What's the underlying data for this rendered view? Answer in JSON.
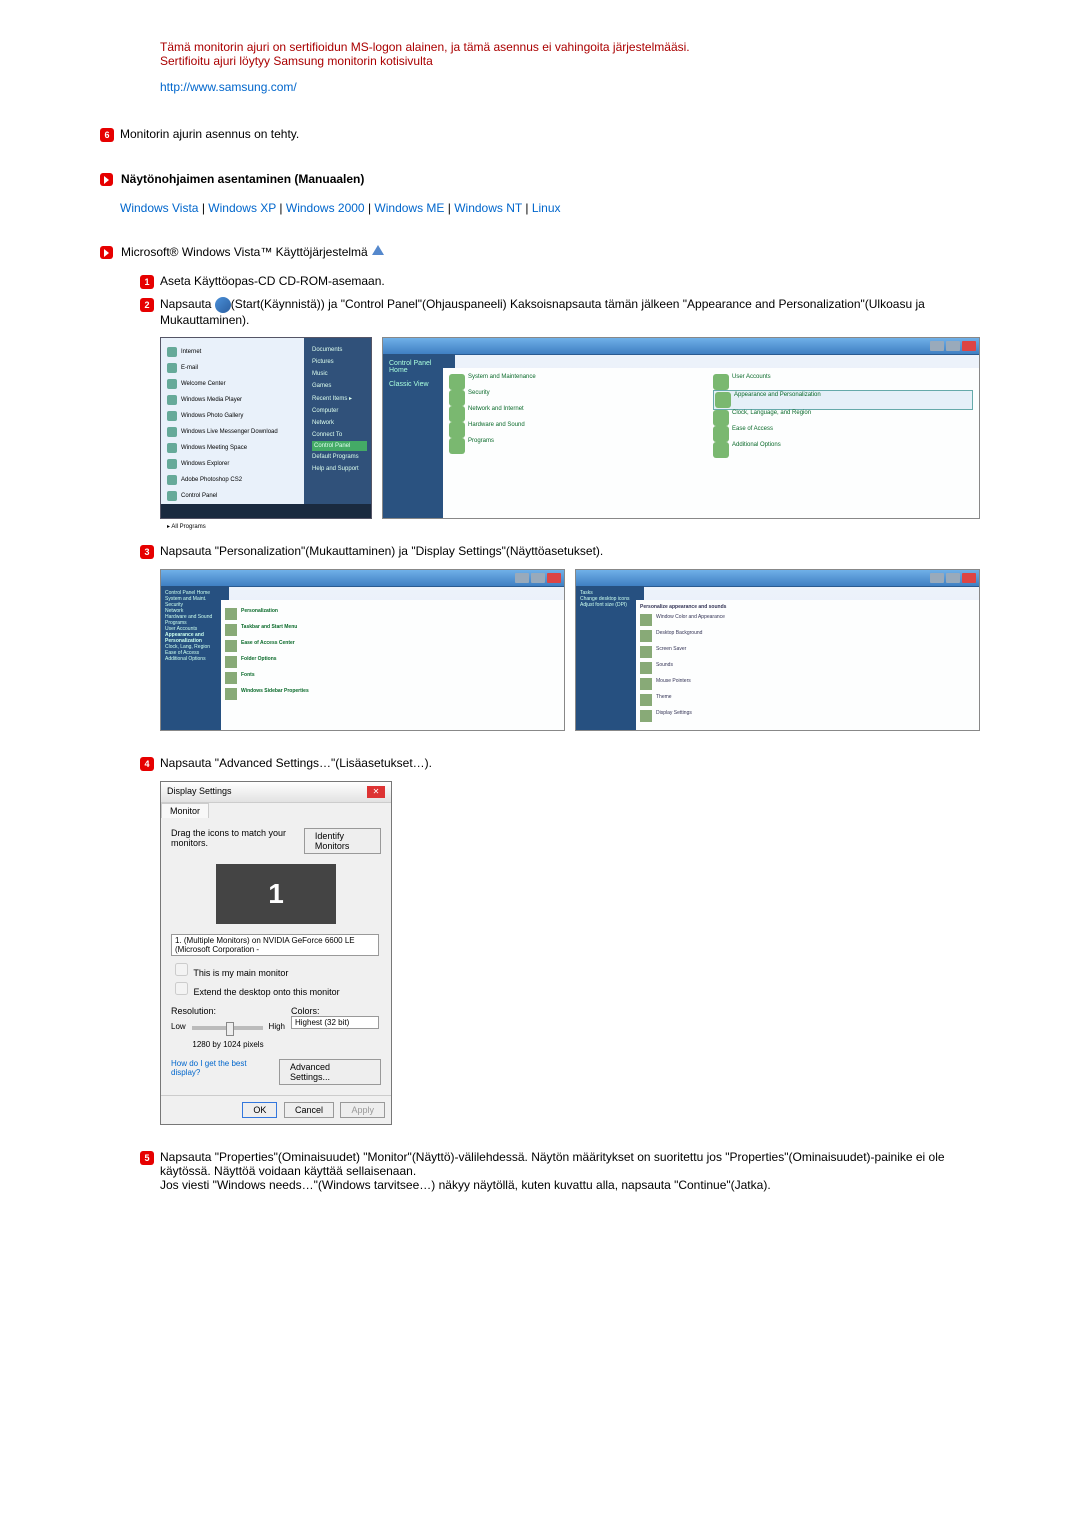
{
  "intro": {
    "line1": "Tämä monitorin ajuri on sertifioidun MS-logon alainen, ja tämä asennus ei vahingoita järjestelmääsi.",
    "line2": "Sertifioitu ajuri löytyy Samsung monitorin kotisivulta",
    "url": "http://www.samsung.com/"
  },
  "step6": "Monitorin ajurin asennus on tehty.",
  "manual_heading": "Näytönohjaimen asentaminen (Manuaalen)",
  "os_links": [
    "Windows Vista",
    "Windows XP",
    "Windows 2000",
    "Windows ME",
    "Windows NT",
    "Linux"
  ],
  "vista_heading": "Microsoft® Windows Vista™ Käyttöjärjestelmä",
  "steps": {
    "s1": "Aseta Käyttöopas-CD CD-ROM-asemaan.",
    "s2a": "Napsauta ",
    "s2b": "(Start(Käynnistä)) ja \"Control Panel\"(Ohjauspaneeli) Kaksoisnapsauta tämän jälkeen \"Appearance and Personalization\"(Ulkoasu ja Mukauttaminen).",
    "s3": "Napsauta \"Personalization\"(Mukauttaminen) ja \"Display Settings\"(Näyttöasetukset).",
    "s4": "Napsauta \"Advanced Settings…\"(Lisäasetukset…).",
    "s5a": "Napsauta \"Properties\"(Ominaisuudet) \"Monitor\"(Näyttö)-välilehdessä. Näytön määritykset on suoritettu jos \"Properties\"(Ominaisuudet)-painike ei ole käytössä. Näyttöä voidaan käyttää sellaisenaan.",
    "s5b": "Jos viesti \"Windows needs…\"(Windows tarvitsee…) näkyy näytöllä, kuten kuvattu alla, napsauta \"Continue\"(Jatka)."
  },
  "display_dialog": {
    "title": "Display Settings",
    "tab": "Monitor",
    "drag_text": "Drag the icons to match your monitors.",
    "identify_btn": "Identify Monitors",
    "monitor_num": "1",
    "dropdown": "1. (Multiple Monitors) on NVIDIA GeForce 6600 LE (Microsoft Corporation -",
    "chk1": "This is my main monitor",
    "chk2": "Extend the desktop onto this monitor",
    "res_label": "Resolution:",
    "low": "Low",
    "high": "High",
    "res_value": "1280 by 1024 pixels",
    "colors_label": "Colors:",
    "colors_value": "Highest (32 bit)",
    "how_link": "How do I get the best display?",
    "adv_btn": "Advanced Settings...",
    "ok": "OK",
    "cancel": "Cancel",
    "apply": "Apply"
  },
  "cp_cats_left": [
    "System and Maintenance",
    "Security",
    "Network and Internet",
    "Hardware and Sound",
    "Programs"
  ],
  "cp_cats_right": [
    "User Accounts",
    "Appearance and Personalization",
    "Clock, Language, and Region",
    "Ease of Access",
    "Additional Options"
  ],
  "sep": " | "
}
